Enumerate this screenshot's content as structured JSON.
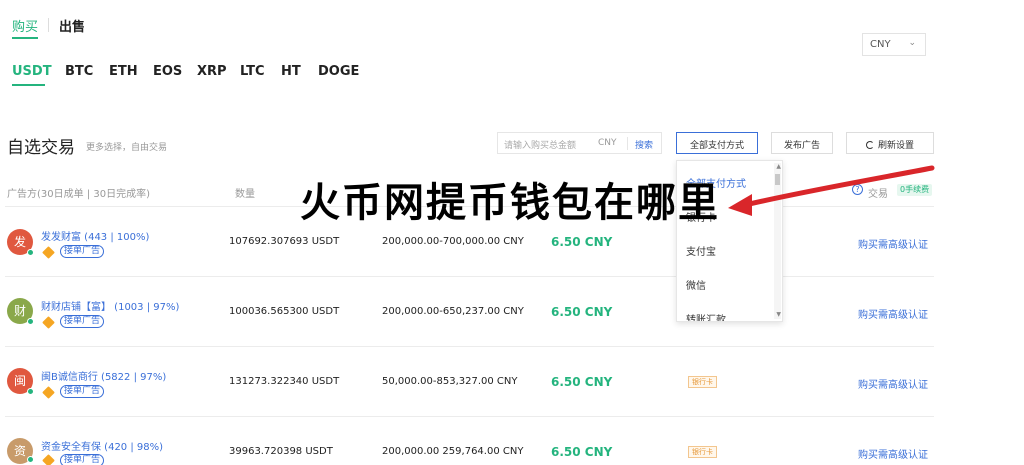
{
  "tabs": {
    "buy": "购买",
    "sell": "出售"
  },
  "currency": {
    "value": "CNY"
  },
  "coins": [
    "USDT",
    "BTC",
    "ETH",
    "EOS",
    "XRP",
    "LTC",
    "HT",
    "DOGE"
  ],
  "section": {
    "title": "自选交易",
    "subtitle": "更多选择，自由交易"
  },
  "filters": {
    "amount_placeholder": "请输入购买总金额",
    "amount_unit": "CNY",
    "search": "搜索",
    "payment_select": "全部支付方式",
    "post_ad": "发布广告",
    "refresh": "刷新设置"
  },
  "table": {
    "headers": {
      "advertiser": "广告方(30日成单 | 30日完成率)",
      "quantity": "数量",
      "trade": "交易",
      "fee": "0手续费"
    },
    "rows": [
      {
        "avatar": "发",
        "avatar_color": "#e0583f",
        "name": "发发财富 (443 | 100%)",
        "tag": "接单广告",
        "qty": "107692.307693 USDT",
        "limit": "200,000.00-700,000.00 CNY",
        "price": "6.50 CNY",
        "pay": "",
        "action": "购买需高级认证"
      },
      {
        "avatar": "财",
        "avatar_color": "#8aa84a",
        "name": "财财店铺【富】 (1003 | 97%)",
        "tag": "接单广告",
        "qty": "100036.565300 USDT",
        "limit": "200,000.00-650,237.00 CNY",
        "price": "6.50 CNY",
        "pay": "",
        "action": "购买需高级认证"
      },
      {
        "avatar": "闽",
        "avatar_color": "#e0583f",
        "name": "闽B诚信商行 (5822 | 97%)",
        "tag": "接单广告",
        "qty": "131273.322340 USDT",
        "limit": "50,000.00-853,327.00 CNY",
        "price": "6.50 CNY",
        "pay": "银行卡",
        "action": "购买需高级认证"
      },
      {
        "avatar": "资",
        "avatar_color": "#c89b6a",
        "name": "资金安全有保 (420 | 98%)",
        "tag": "接单广告",
        "qty": "39963.720398 USDT",
        "limit": "200,000.00 259,764.00 CNY",
        "price": "6.50 CNY",
        "pay": "银行卡",
        "action": "购买需高级认证"
      }
    ]
  },
  "dropdown": {
    "options": [
      "全部支付方式",
      "银行卡",
      "支付宝",
      "微信",
      "转账汇款"
    ]
  },
  "overlay": {
    "banner": "火币网提币钱包在哪里",
    "arrow_color": "#d9262a"
  },
  "colors": {
    "accent_green": "#24b47e",
    "link_blue": "#3a6fd8"
  }
}
